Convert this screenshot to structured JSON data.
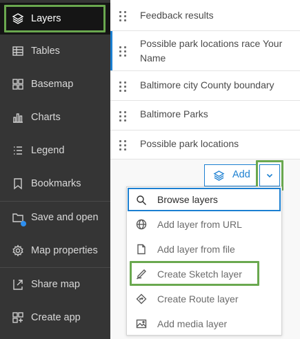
{
  "sidebar": {
    "items": [
      {
        "label": "Layers",
        "icon": "layers-icon",
        "active": true
      },
      {
        "label": "Tables",
        "icon": "table-icon"
      },
      {
        "label": "Basemap",
        "icon": "basemap-icon"
      },
      {
        "label": "Charts",
        "icon": "chart-icon"
      },
      {
        "label": "Legend",
        "icon": "legend-icon"
      },
      {
        "label": "Bookmarks",
        "icon": "bookmark-icon"
      },
      {
        "label": "Save and open",
        "icon": "save-folder-icon"
      },
      {
        "label": "Map properties",
        "icon": "gear-icon"
      },
      {
        "label": "Share map",
        "icon": "share-icon"
      },
      {
        "label": "Create app",
        "icon": "create-app-icon"
      }
    ]
  },
  "layers": [
    {
      "title": "Feedback results"
    },
    {
      "title": "Possible park locations race Your Name",
      "selected": true
    },
    {
      "title": "Baltimore city County boundary"
    },
    {
      "title": "Baltimore Parks"
    },
    {
      "title": "Possible park locations"
    }
  ],
  "add_button": {
    "label": "Add",
    "icon": "layers-add-icon"
  },
  "dropdown_toggle": {
    "icon": "chevron-down-icon"
  },
  "add_menu": {
    "items": [
      {
        "label": "Browse layers",
        "icon": "search-icon",
        "focused": true
      },
      {
        "label": "Add layer from URL",
        "icon": "globe-icon"
      },
      {
        "label": "Add layer from file",
        "icon": "file-icon"
      },
      {
        "label": "Create Sketch layer",
        "icon": "sketch-pen-icon"
      },
      {
        "label": "Create Route layer",
        "icon": "route-icon"
      },
      {
        "label": "Add media layer",
        "icon": "image-icon"
      }
    ]
  },
  "colors": {
    "sidebar_bg": "#353535",
    "sidebar_active_bg": "#151515",
    "accent": "#1b7fd1",
    "highlight": "#6aa84f",
    "notification_dot": "#2d8ff0"
  }
}
